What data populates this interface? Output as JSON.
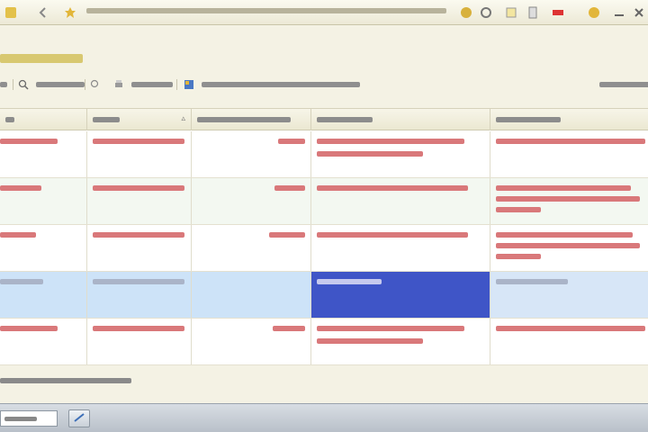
{
  "window": {
    "title": ""
  },
  "page": {
    "heading": ""
  },
  "toolbar": {
    "find_label": "",
    "print_label": "",
    "stock_label": "",
    "all_actions_label": ""
  },
  "table": {
    "columns": [
      {
        "key": "number",
        "label": ""
      },
      {
        "key": "date",
        "label": ""
      },
      {
        "key": "amount",
        "label": ""
      },
      {
        "key": "status",
        "label": ""
      },
      {
        "key": "contractor",
        "label": ""
      }
    ],
    "rows": [
      {
        "amount": "",
        "state": "normal"
      },
      {
        "amount": "",
        "state": "alt"
      },
      {
        "amount": "",
        "state": "normal"
      },
      {
        "amount": "",
        "state": "selected"
      },
      {
        "amount": "",
        "state": "normal"
      }
    ]
  },
  "footer": {
    "status": ""
  },
  "taskbar": {
    "input_value": ""
  },
  "colors": {
    "accent_text": "#d8c870",
    "row_text": "#c23030",
    "selected_row": "#cde3f8",
    "selected_cell": "#3f55c7"
  }
}
